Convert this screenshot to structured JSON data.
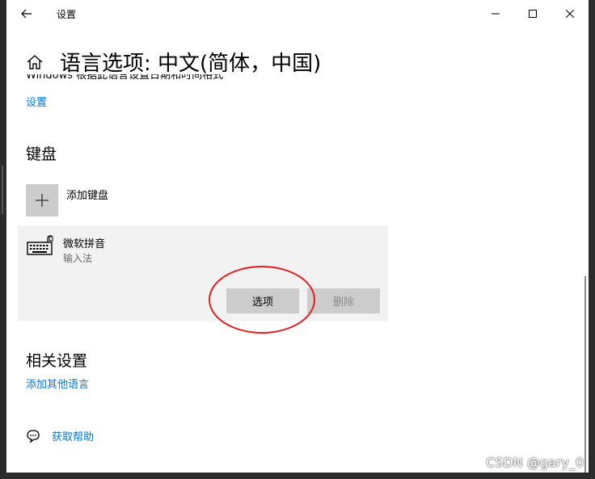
{
  "window": {
    "title": "设置",
    "back_icon": "arrow-left-icon",
    "minimize_icon": "minimize-icon",
    "maximize_icon": "maximize-icon",
    "close_icon": "close-icon"
  },
  "header": {
    "icon": "home-icon",
    "title": "语言选项: 中文(简体，中国)"
  },
  "region_section": {
    "partial_text": "Windows 根据此语言设置日期和时间格式",
    "settings_link": "设置"
  },
  "keyboard_section": {
    "heading": "键盘",
    "add_keyboard_label": "添加键盘",
    "ime": {
      "name": "微软拼音",
      "subtitle": "输入法",
      "options_button": "选项",
      "remove_button": "删除"
    }
  },
  "related_section": {
    "heading": "相关设置",
    "add_language_link": "添加其他语言"
  },
  "help": {
    "icon": "help-chat-icon",
    "link": "获取帮助"
  },
  "watermark": "CSDN @gary_0",
  "colors": {
    "accent": "#0078d7",
    "annotation": "#e02020",
    "panel_bg": "#f2f2f2",
    "button_bg": "#cccccc"
  }
}
